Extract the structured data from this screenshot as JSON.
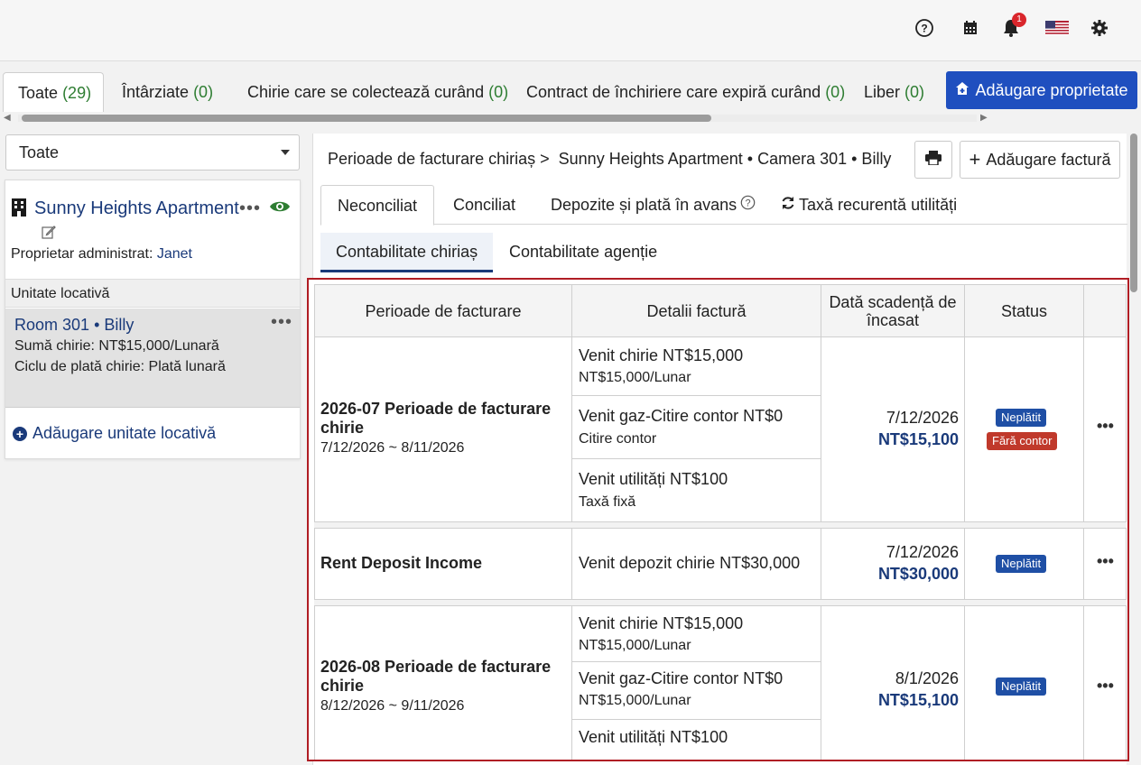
{
  "topbar": {
    "notification_count": "1"
  },
  "filter_tabs": [
    {
      "label": "Toate",
      "count": "(29)"
    },
    {
      "label": "Întârziate",
      "count": "(0)"
    },
    {
      "label": "Chirie care se colectează curând",
      "count": "(0)"
    },
    {
      "label": "Contract de închiriere care expiră curând",
      "count": "(0)"
    },
    {
      "label": "Liber",
      "count": "(0)"
    }
  ],
  "add_property_label": "Adăugare proprietate",
  "left": {
    "filter_value": "Toate",
    "property_name": "Sunny Heights Apartment",
    "owner_label": "Proprietar administrat:",
    "owner_name": "Janet",
    "unit_header": "Unitate locativă",
    "unit": {
      "room": "Room 301",
      "tenant": "Billy",
      "rent_line": "Sumă chirie: NT$15,000/Lunară",
      "cycle_line": "Ciclu de plată chirie: Plată lunară"
    },
    "add_unit_label": "Adăugare unitate locativă"
  },
  "right": {
    "breadcrumb_root": "Perioade de facturare chiriaș >",
    "breadcrumb_current": "Sunny Heights Apartment • Camera 301 • Billy",
    "add_invoice_label": "Adăugare factură",
    "status_tabs": [
      "Neconciliat",
      "Conciliat",
      "Depozite și plată în avans",
      "Taxă recurentă utilități"
    ],
    "sub_tabs": [
      "Contabilitate chiriaș",
      "Contabilitate agenție"
    ]
  },
  "table": {
    "headers": [
      "Perioade de facturare",
      "Detalii factură",
      "Dată scadență de încasat",
      "Status"
    ],
    "rows": [
      {
        "title": "2026-07 Perioade de facturare chirie",
        "dates": "7/12/2026 ~ 8/11/2026",
        "details": [
          {
            "main": "Venit chirie NT$15,000",
            "sub": "NT$15,000/Lunar"
          },
          {
            "main": "Venit gaz-Citire contor NT$0",
            "sub": "Citire contor"
          },
          {
            "main": "Venit utilități NT$100",
            "sub": "Taxă fixă"
          }
        ],
        "due_date": "7/12/2026",
        "due_amount": "NT$15,100",
        "status": "Neplătit",
        "status2": "Fără contor"
      },
      {
        "title": "Rent Deposit Income",
        "details": [
          {
            "main": "Venit depozit chirie NT$30,000"
          }
        ],
        "due_date": "7/12/2026",
        "due_amount": "NT$30,000",
        "status": "Neplătit"
      },
      {
        "title": "2026-08 Perioade de facturare chirie",
        "dates": "8/12/2026 ~ 9/11/2026",
        "details": [
          {
            "main": "Venit chirie NT$15,000",
            "sub": "NT$15,000/Lunar"
          },
          {
            "main": "Venit gaz-Citire contor NT$0",
            "sub": "NT$15,000/Lunar"
          },
          {
            "main": "Venit utilități NT$100"
          }
        ],
        "due_date": "8/1/2026",
        "due_amount": "NT$15,100",
        "status": "Neplătit"
      }
    ]
  },
  "colors": {
    "brand_blue": "#1f4fbf",
    "link_navy": "#1a3a7a",
    "count_green": "#2e7d32",
    "highlight_red": "#b01d24",
    "badge_unpaid": "#1f4fa5",
    "badge_no_meter": "#c0392b"
  },
  "icons": [
    "help-icon",
    "calendar-icon",
    "bell-icon",
    "us-flag-icon",
    "gear-icon",
    "home-plus-icon",
    "building-icon",
    "edit-icon",
    "eye-icon",
    "print-icon",
    "plus-icon",
    "info-icon",
    "refresh-icon",
    "plus-circle-icon"
  ]
}
